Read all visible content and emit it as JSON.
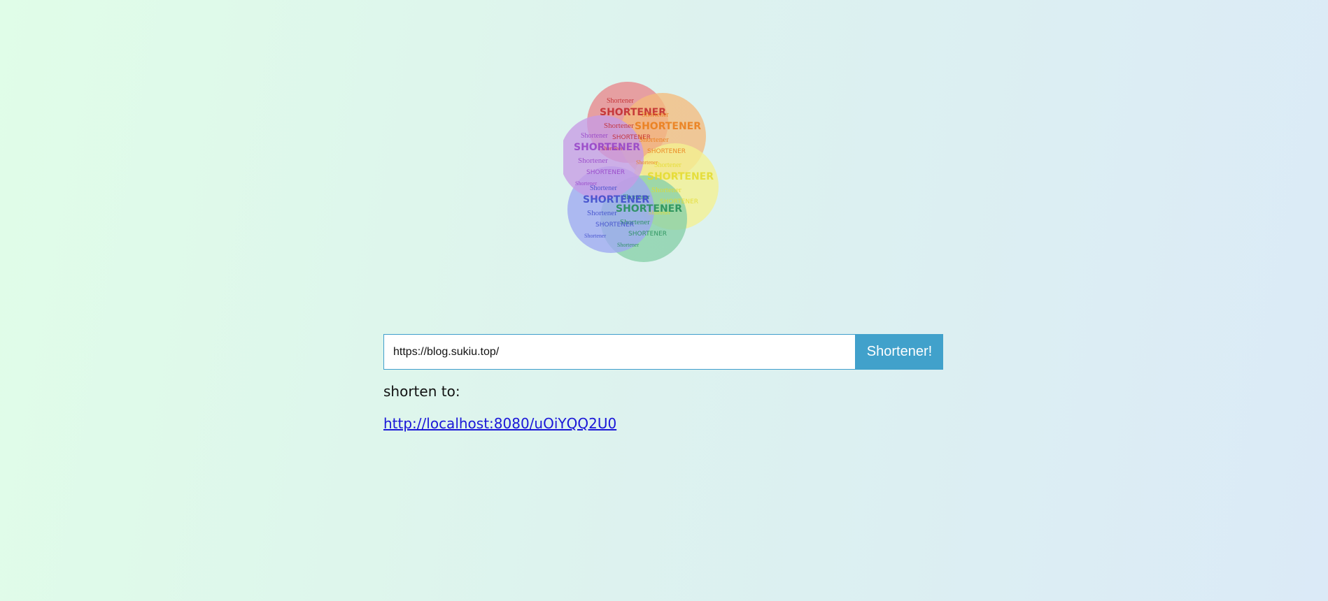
{
  "logo": {
    "word": "Shortener",
    "word_caps": "SHORTENER",
    "petal_colors": [
      "#e8878c",
      "#f4bb7e",
      "#f4f191",
      "#86cfa8",
      "#9ea8f2",
      "#c69be6"
    ],
    "petal_text_colors": [
      "#c0262a",
      "#ea7a14",
      "#e3da2a",
      "#1f8c54",
      "#3a46c9",
      "#9440c6"
    ]
  },
  "form": {
    "url_value": "https://blog.sukiu.top/",
    "submit_label": "Shortener!"
  },
  "result": {
    "label": "shorten to:",
    "link": "http://localhost:8080/uOiYQQ2U0"
  }
}
